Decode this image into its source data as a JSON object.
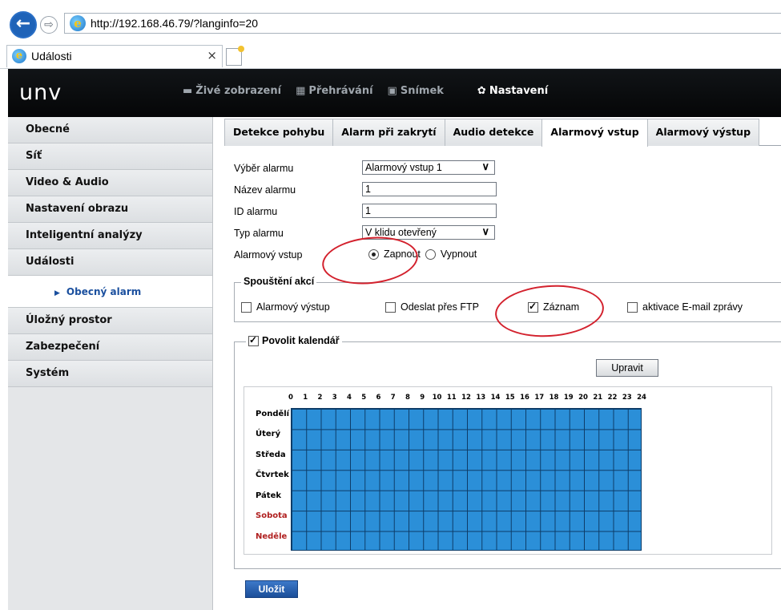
{
  "browser": {
    "back_glyph": "←",
    "forward_glyph": "⇨",
    "url": "http://192.168.46.79/?langinfo=20",
    "tab_title": "Události",
    "tab_close": "×",
    "ie_glyph": "e"
  },
  "header": {
    "logo": "unv",
    "nav": [
      {
        "icon": "monitor-icon",
        "glyph": "▬",
        "label": "Živé zobrazení"
      },
      {
        "icon": "playback-icon",
        "glyph": "▦",
        "label": "Přehrávání"
      },
      {
        "icon": "picture-icon",
        "glyph": "▣",
        "label": "Snímek"
      },
      {
        "icon": "gear-icon",
        "glyph": "✿",
        "label": "Nastavení",
        "active": true
      }
    ]
  },
  "sidebar": {
    "items": [
      "Obecné",
      "Síť",
      "Video & Audio",
      "Nastavení obrazu",
      "Inteligentní analýzy",
      "Události"
    ],
    "sub_item": "Obecný alarm",
    "items_after": [
      "Úložný prostor",
      "Zabezpečení",
      "Systém"
    ]
  },
  "tabs": [
    "Detekce pohybu",
    "Alarm při zakrytí",
    "Audio detekce",
    "Alarmový vstup",
    "Alarmový výstup"
  ],
  "active_tab": "Alarmový vstup",
  "form": {
    "select_label": "Výběr alarmu",
    "select_value": "Alarmový vstup 1",
    "name_label": "Název alarmu",
    "name_value": "1",
    "id_label": "ID alarmu",
    "id_value": "1",
    "type_label": "Typ alarmu",
    "type_value": "V klidu otevřený",
    "input_label": "Alarmový vstup",
    "radio_on": "Zapnout",
    "radio_off": "Vypnout",
    "radio_selected": "Zapnout"
  },
  "actions": {
    "legend": "Spouštění akcí",
    "items": [
      {
        "label": "Alarmový výstup",
        "checked": false
      },
      {
        "label": "Odeslat přes FTP",
        "checked": false
      },
      {
        "label": "Záznam",
        "checked": true
      },
      {
        "label": "aktivace E-mail zprávy",
        "checked": false
      }
    ]
  },
  "calendar": {
    "legend": "Povolit kalendář",
    "enabled": true,
    "edit_button": "Upravit",
    "hours": [
      "0",
      "1",
      "2",
      "3",
      "4",
      "5",
      "6",
      "7",
      "8",
      "9",
      "10",
      "11",
      "12",
      "13",
      "14",
      "15",
      "16",
      "17",
      "18",
      "19",
      "20",
      "21",
      "22",
      "23",
      "24"
    ],
    "days": [
      {
        "label": "Pondělí",
        "weekend": false
      },
      {
        "label": "Úterý",
        "weekend": false
      },
      {
        "label": "Středa",
        "weekend": false
      },
      {
        "label": "Čtvrtek",
        "weekend": false
      },
      {
        "label": "Pátek",
        "weekend": false
      },
      {
        "label": "Sobota",
        "weekend": true
      },
      {
        "label": "Neděle",
        "weekend": true
      }
    ],
    "fill_color": "#2b8fd8",
    "armed_fraction": 1.0
  },
  "save_button": "Uložit",
  "annotation_color": "#d3212d"
}
